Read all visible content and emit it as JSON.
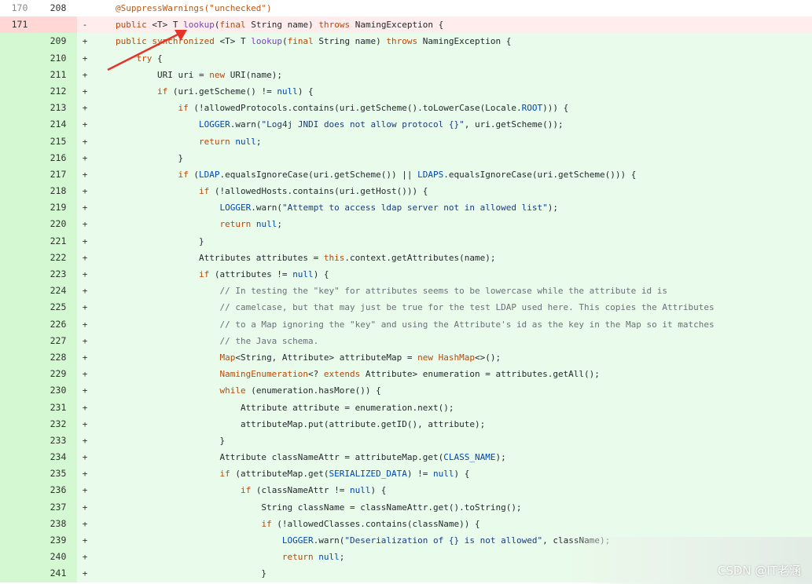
{
  "rows": [
    {
      "type": "ctx",
      "old": "170",
      "new": "208",
      "mark": "",
      "html": "<span class=\"an\">@SuppressWarnings(\"unchecked\")</span>"
    },
    {
      "type": "del",
      "old": "171",
      "new": "",
      "mark": "-",
      "html": "<span class=\"kw\">public</span> &lt;T&gt; T <span class=\"fn\">lookup</span>(<span class=\"kw\">final</span> String name) <span class=\"kw\">throws</span> NamingException {"
    },
    {
      "type": "add",
      "old": "",
      "new": "209",
      "mark": "+",
      "html": "<span class=\"kw\">public synchronized</span> &lt;T&gt; T <span class=\"fn\">lookup</span>(<span class=\"kw\">final</span> String name) <span class=\"kw\">throws</span> NamingException {"
    },
    {
      "type": "add",
      "old": "",
      "new": "210",
      "mark": "+",
      "html": "    <span class=\"kw\">try</span> {"
    },
    {
      "type": "add",
      "old": "",
      "new": "211",
      "mark": "+",
      "html": "        URI uri = <span class=\"kw\">new</span> URI(name);"
    },
    {
      "type": "add",
      "old": "",
      "new": "212",
      "mark": "+",
      "html": "        <span class=\"kw\">if</span> (uri.getScheme() != <span class=\"id\">null</span>) {"
    },
    {
      "type": "add",
      "old": "",
      "new": "213",
      "mark": "+",
      "html": "            <span class=\"kw\">if</span> (!allowedProtocols.contains(uri.getScheme().toLowerCase(Locale.<span class=\"id\">ROOT</span>))) {"
    },
    {
      "type": "add",
      "old": "",
      "new": "214",
      "mark": "+",
      "html": "                <span class=\"id\">LOGGER</span>.warn(<span class=\"str\">\"Log4j JNDI does not allow protocol {}\"</span>, uri.getScheme());"
    },
    {
      "type": "add",
      "old": "",
      "new": "215",
      "mark": "+",
      "html": "                <span class=\"kw\">return</span> <span class=\"id\">null</span>;"
    },
    {
      "type": "add",
      "old": "",
      "new": "216",
      "mark": "+",
      "html": "            }"
    },
    {
      "type": "add",
      "old": "",
      "new": "217",
      "mark": "+",
      "html": "            <span class=\"kw\">if</span> (<span class=\"id\">LDAP</span>.equalsIgnoreCase(uri.getScheme()) || <span class=\"id\">LDAPS</span>.equalsIgnoreCase(uri.getScheme())) {"
    },
    {
      "type": "add",
      "old": "",
      "new": "218",
      "mark": "+",
      "html": "                <span class=\"kw\">if</span> (!allowedHosts.contains(uri.getHost())) {"
    },
    {
      "type": "add",
      "old": "",
      "new": "219",
      "mark": "+",
      "html": "                    <span class=\"id\">LOGGER</span>.warn(<span class=\"str\">\"Attempt to access ldap server not in allowed list\"</span>);"
    },
    {
      "type": "add",
      "old": "",
      "new": "220",
      "mark": "+",
      "html": "                    <span class=\"kw\">return</span> <span class=\"id\">null</span>;"
    },
    {
      "type": "add",
      "old": "",
      "new": "221",
      "mark": "+",
      "html": "                }"
    },
    {
      "type": "add",
      "old": "",
      "new": "222",
      "mark": "+",
      "html": "                Attributes attributes = <span class=\"kw\">this</span>.context.getAttributes(name);"
    },
    {
      "type": "add",
      "old": "",
      "new": "223",
      "mark": "+",
      "html": "                <span class=\"kw\">if</span> (attributes != <span class=\"id\">null</span>) {"
    },
    {
      "type": "add",
      "old": "",
      "new": "224",
      "mark": "+",
      "html": "                    <span class=\"cm\">// In testing the \"key\" for attributes seems to be lowercase while the attribute id is</span>"
    },
    {
      "type": "add",
      "old": "",
      "new": "225",
      "mark": "+",
      "html": "                    <span class=\"cm\">// camelcase, but that may just be true for the test LDAP used here. This copies the Attributes</span>"
    },
    {
      "type": "add",
      "old": "",
      "new": "226",
      "mark": "+",
      "html": "                    <span class=\"cm\">// to a Map ignoring the \"key\" and using the Attribute's id as the key in the Map so it matches</span>"
    },
    {
      "type": "add",
      "old": "",
      "new": "227",
      "mark": "+",
      "html": "                    <span class=\"cm\">// the Java schema.</span>"
    },
    {
      "type": "add",
      "old": "",
      "new": "228",
      "mark": "+",
      "html": "                    <span class=\"kw\">Map</span>&lt;String, Attribute&gt; attributeMap = <span class=\"kw\">new</span> <span class=\"kw\">HashMap</span>&lt;&gt;();"
    },
    {
      "type": "add",
      "old": "",
      "new": "229",
      "mark": "+",
      "html": "                    <span class=\"kw\">NamingEnumeration</span>&lt;? <span class=\"kw\">extends</span> Attribute&gt; enumeration = attributes.getAll();"
    },
    {
      "type": "add",
      "old": "",
      "new": "230",
      "mark": "+",
      "html": "                    <span class=\"kw\">while</span> (enumeration.hasMore()) {"
    },
    {
      "type": "add",
      "old": "",
      "new": "231",
      "mark": "+",
      "html": "                        Attribute attribute = enumeration.next();"
    },
    {
      "type": "add",
      "old": "",
      "new": "232",
      "mark": "+",
      "html": "                        attributeMap.put(attribute.getID(), attribute);"
    },
    {
      "type": "add",
      "old": "",
      "new": "233",
      "mark": "+",
      "html": "                    }"
    },
    {
      "type": "add",
      "old": "",
      "new": "234",
      "mark": "+",
      "html": "                    Attribute classNameAttr = attributeMap.get(<span class=\"id\">CLASS_NAME</span>);"
    },
    {
      "type": "add",
      "old": "",
      "new": "235",
      "mark": "+",
      "html": "                    <span class=\"kw\">if</span> (attributeMap.get(<span class=\"id\">SERIALIZED_DATA</span>) != <span class=\"id\">null</span>) {"
    },
    {
      "type": "add",
      "old": "",
      "new": "236",
      "mark": "+",
      "html": "                        <span class=\"kw\">if</span> (classNameAttr != <span class=\"id\">null</span>) {"
    },
    {
      "type": "add",
      "old": "",
      "new": "237",
      "mark": "+",
      "html": "                            String className = classNameAttr.get().toString();"
    },
    {
      "type": "add",
      "old": "",
      "new": "238",
      "mark": "+",
      "html": "                            <span class=\"kw\">if</span> (!allowedClasses.contains(className)) {"
    },
    {
      "type": "add",
      "old": "",
      "new": "239",
      "mark": "+",
      "html": "                                <span class=\"id\">LOGGER</span>.warn(<span class=\"str\">\"Deserialization of {} is not allowed\"</span>, className);"
    },
    {
      "type": "add",
      "old": "",
      "new": "240",
      "mark": "+",
      "html": "                                <span class=\"kw\">return</span> <span class=\"id\">null</span>;"
    },
    {
      "type": "add",
      "old": "",
      "new": "241",
      "mark": "+",
      "html": "                            }"
    }
  ],
  "watermark": "CSDN @IT老涵",
  "colors": {
    "arrow": "#e8332a",
    "added_bg": "#e9fbea",
    "deleted_bg": "#ffecec"
  }
}
